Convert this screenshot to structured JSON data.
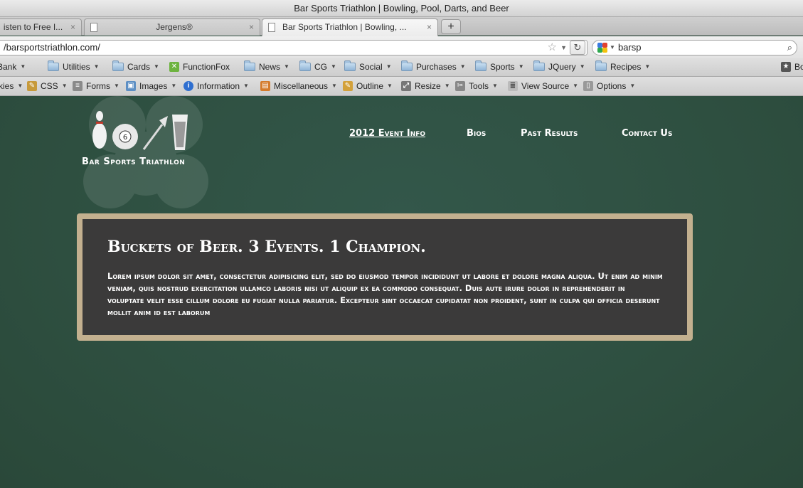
{
  "window": {
    "title": "Bar Sports Triathlon | Bowling, Pool, Darts, and Beer"
  },
  "tabs": [
    {
      "label": "isten to Free I...",
      "close": "×"
    },
    {
      "label": "Jergens®",
      "close": "×"
    },
    {
      "label": "Bar Sports Triathlon | Bowling, ...",
      "close": "×"
    }
  ],
  "new_tab_label": "+",
  "address_bar": {
    "url": "/barsportstriathlon.com/"
  },
  "search_bar": {
    "query": "barsp"
  },
  "bookmarks": [
    {
      "label": "Bank"
    },
    {
      "label": "Utilities"
    },
    {
      "label": "Cards"
    },
    {
      "label": "FunctionFox"
    },
    {
      "label": "News"
    },
    {
      "label": "CG"
    },
    {
      "label": "Social"
    },
    {
      "label": "Purchases"
    },
    {
      "label": "Sports"
    },
    {
      "label": "JQuery"
    },
    {
      "label": "Recipes"
    },
    {
      "label": "Bo"
    }
  ],
  "dev_toolbar": [
    {
      "label": "kies"
    },
    {
      "label": "CSS"
    },
    {
      "label": "Forms"
    },
    {
      "label": "Images"
    },
    {
      "label": "Information"
    },
    {
      "label": "Miscellaneous"
    },
    {
      "label": "Outline"
    },
    {
      "label": "Resize"
    },
    {
      "label": "Tools"
    },
    {
      "label": "View Source"
    },
    {
      "label": "Options"
    }
  ],
  "site": {
    "logo_text": "Bar Sports Triathlon",
    "nav": [
      {
        "label": "2012 Event Info"
      },
      {
        "label": "Bios"
      },
      {
        "label": "Past Results"
      },
      {
        "label": "Contact Us"
      }
    ],
    "hero": {
      "title": "Buckets of Beer. 3 Events. 1 Champion.",
      "body": "Lorem ipsum dolor sit amet, consectetur adipisicing elit, sed do eiusmod tempor incididunt ut labore et dolore magna aliqua. Ut enim ad minim veniam, quis nostrud exercitation ullamco laboris nisi ut aliquip ex ea commodo consequat. Duis aute irure dolor in reprehenderit in voluptate velit esse cillum dolore eu fugiat nulla pariatur. Excepteur sint occaecat cupidatat non proident, sunt in culpa qui officia deserunt mollit anim id est laborum"
    }
  },
  "colors": {
    "page_background": "#2e4f3f",
    "hero_border": "#c3b08f",
    "hero_background": "#3b3a3a",
    "text": "#ffffff"
  }
}
